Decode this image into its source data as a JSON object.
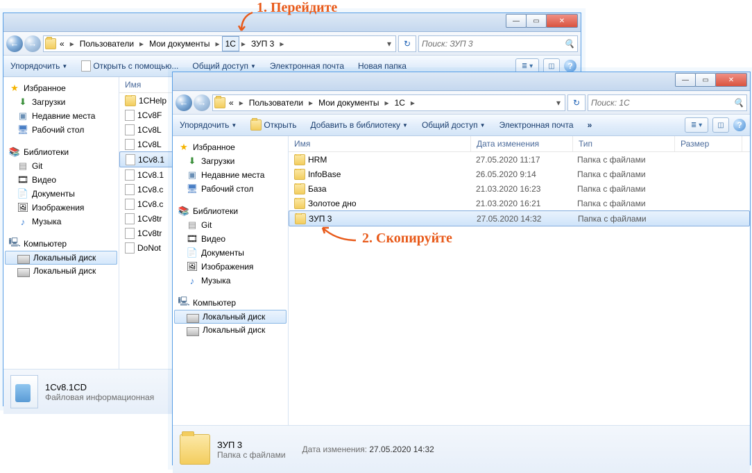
{
  "annot1": "1. Перейдите",
  "annot2": "2. Скопируйте",
  "win1": {
    "breadcrumb": [
      "«",
      "Пользователи",
      "Мои документы",
      "1C",
      "ЗУП 3"
    ],
    "search_ph": "Поиск: ЗУП 3",
    "toolbar": {
      "organize": "Упорядочить",
      "openwith": "Открыть с помощью...",
      "share": "Общий доступ",
      "email": "Электронная почта",
      "newfolder": "Новая папка"
    },
    "nav": {
      "fav": "Избранное",
      "downloads": "Загрузки",
      "recent": "Недавние места",
      "desktop": "Рабочий стол",
      "libs": "Библиотеки",
      "git": "Git",
      "video": "Видео",
      "docs": "Документы",
      "images": "Изображения",
      "music": "Музыка",
      "computer": "Компьютер",
      "disk1": "Локальный диск",
      "disk2": "Локальный диск"
    },
    "col_name": "Имя",
    "files": [
      "1CHelp",
      "1Cv8F",
      "1Cv8L",
      "1Cv8L",
      "1Cv8.1",
      "1Cv8.1",
      "1Cv8.c",
      "1Cv8.c",
      "1Cv8tr",
      "1Cv8tr",
      "DoNot"
    ],
    "sel_file": "1Cv8.1",
    "status": {
      "name": "1Cv8.1CD",
      "desc": "Файловая информационная"
    }
  },
  "win2": {
    "breadcrumb": [
      "«",
      "Пользователи",
      "Мои документы",
      "1C"
    ],
    "search_ph": "Поиск: 1C",
    "toolbar": {
      "organize": "Упорядочить",
      "open": "Открыть",
      "addlib": "Добавить в библиотеку",
      "share": "Общий доступ",
      "email": "Электронная почта"
    },
    "nav": {
      "fav": "Избранное",
      "downloads": "Загрузки",
      "recent": "Недавние места",
      "desktop": "Рабочий стол",
      "libs": "Библиотеки",
      "git": "Git",
      "video": "Видео",
      "docs": "Документы",
      "images": "Изображения",
      "music": "Музыка",
      "computer": "Компьютер",
      "disk1": "Локальный диск",
      "disk2": "Локальный диск"
    },
    "cols": {
      "name": "Имя",
      "date": "Дата изменения",
      "type": "Тип",
      "size": "Размер"
    },
    "rows": [
      {
        "name": "HRM",
        "date": "27.05.2020 11:17",
        "type": "Папка с файлами"
      },
      {
        "name": "InfoBase",
        "date": "26.05.2020 9:14",
        "type": "Папка с файлами"
      },
      {
        "name": "База",
        "date": "21.03.2020 16:23",
        "type": "Папка с файлами"
      },
      {
        "name": "Золотое дно",
        "date": "21.03.2020 16:21",
        "type": "Папка с файлами"
      },
      {
        "name": "ЗУП 3",
        "date": "27.05.2020 14:32",
        "type": "Папка с файлами"
      }
    ],
    "status": {
      "name": "ЗУП 3",
      "type": "Папка с файлами",
      "date_lbl": "Дата изменения:",
      "date": "27.05.2020 14:32"
    }
  }
}
